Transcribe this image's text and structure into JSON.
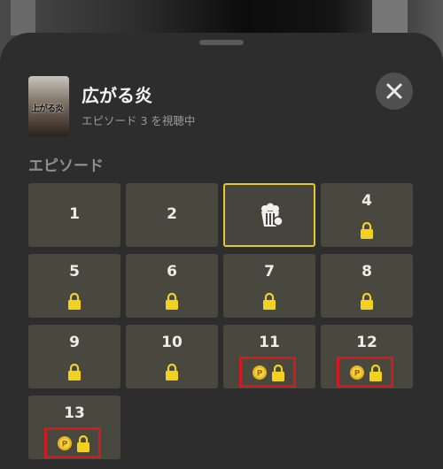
{
  "header": {
    "title": "広がる炎",
    "subtitle": "エピソード 3 を視聴中",
    "poster_text": "上がる炎"
  },
  "section": {
    "label": "エピソード"
  },
  "colors": {
    "lock": "#f2d21e",
    "current_border": "#e6c62d",
    "highlight_box": "#d11a22"
  },
  "episodes": [
    {
      "number": "1",
      "state": "unlocked"
    },
    {
      "number": "2",
      "state": "unlocked"
    },
    {
      "number": "",
      "state": "playing",
      "icon": "popcorn-icon"
    },
    {
      "number": "4",
      "state": "locked"
    },
    {
      "number": "5",
      "state": "locked"
    },
    {
      "number": "6",
      "state": "locked"
    },
    {
      "number": "7",
      "state": "locked"
    },
    {
      "number": "8",
      "state": "locked"
    },
    {
      "number": "9",
      "state": "locked"
    },
    {
      "number": "10",
      "state": "locked"
    },
    {
      "number": "11",
      "state": "locked-coin"
    },
    {
      "number": "12",
      "state": "locked-coin"
    },
    {
      "number": "13",
      "state": "locked-coin"
    }
  ]
}
